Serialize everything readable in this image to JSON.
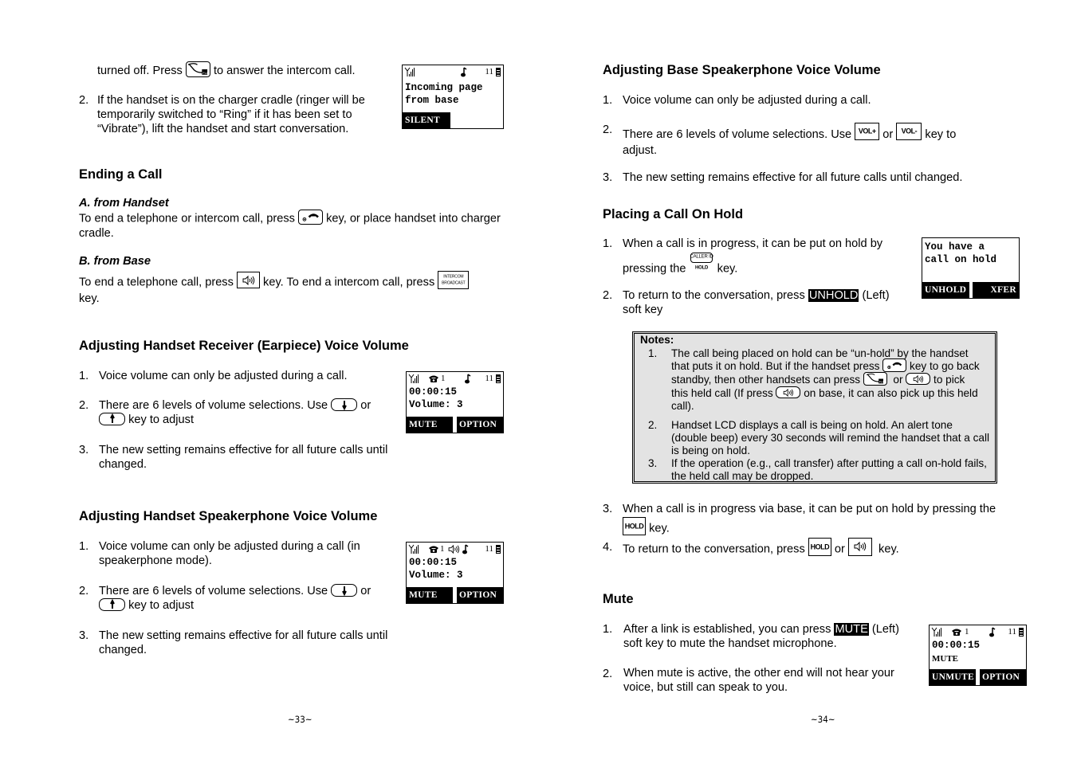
{
  "left_page": {
    "intro": {
      "line1_before": "turned off. Press",
      "line1_after": "to answer the intercom call.",
      "item2_num": "2.",
      "item2_text": "If the handset is on the charger cradle (ringer will be temporarily switched to “Ring” if it has been set to “Vibrate”), lift the handset and start conversation.",
      "lcd": {
        "line1": "Incoming page",
        "line2": "from base",
        "soft_left": "SILENT",
        "status_right": "11"
      }
    },
    "ending_call": {
      "title": "Ending a Call",
      "a_title": "A. from Handset",
      "a_before": "To end a telephone or intercom call, press",
      "a_after": "key, or place handset into charger cradle.",
      "b_title": "B. from Base",
      "b_before": "To end a telephone call, press",
      "b_mid": "key. To end a intercom call, press",
      "b_after": "key.",
      "intercom_key_line1": "INTERCOM",
      "intercom_key_line2": "BROADCAST"
    },
    "receiver_volume": {
      "title": "Adjusting Handset Receiver (Earpiece) Voice Volume",
      "items": [
        {
          "num": "1.",
          "text": "Voice volume can only be adjusted during a call."
        },
        {
          "num": "2.",
          "before": "There are 6 levels of volume selections.  Use",
          "mid": "or",
          "after": "key to adjust"
        },
        {
          "num": "3.",
          "text": "The new setting remains effective for all future calls until changed."
        }
      ],
      "lcd": {
        "line1": "00:00:15",
        "line2": "Volume: 3",
        "soft_left": "MUTE",
        "soft_right": "OPTION",
        "line_no": "1",
        "status_right": "11"
      }
    },
    "speaker_volume": {
      "title": "Adjusting Handset Speakerphone Voice Volume",
      "items": [
        {
          "num": "1.",
          "text": "Voice volume can only be adjusted during a call (in speakerphone mode)."
        },
        {
          "num": "2.",
          "before": "There are 6 levels of volume selections.  Use",
          "mid": "or",
          "after": "key to adjust"
        },
        {
          "num": "3.",
          "text": "The new setting remains effective for all future calls until changed."
        }
      ],
      "lcd": {
        "line1": "00:00:15",
        "line2": "Volume: 3",
        "soft_left": "MUTE",
        "soft_right": "OPTION",
        "line_no": "1",
        "status_right": "11"
      }
    },
    "page_number": "~33~"
  },
  "right_page": {
    "base_volume": {
      "title": "Adjusting Base Speakerphone Voice Volume",
      "item1_num": "1.",
      "item1_text": "Voice volume can only be adjusted during a call.",
      "item2_num": "2.",
      "item2_before": "There are 6 levels of volume selections.  Use",
      "item2_mid": "or",
      "item2_after": "key to",
      "item2_cont": "adjust.",
      "vol_up_key": "VOL+",
      "vol_down_key": "VOL-",
      "item3_num": "3.",
      "item3_text": "The new setting remains effective for all future calls until changed."
    },
    "hold": {
      "title": "Placing a Call On Hold",
      "item1_num": "1.",
      "item1_line1": "When a call is in progress, it can be put on hold by",
      "item1_before": "pressing the",
      "item1_after": "key.",
      "callerid_key_top": "CALLER ID",
      "callerid_key_bottom": "HOLD",
      "item2_num": "2.",
      "item2_before": "To return to the conversation, press",
      "item2_highlight": "UNHOLD",
      "item2_after": "(Left)",
      "item2_cont": "soft key",
      "lcd": {
        "line1": "You have a",
        "line2": "call on hold",
        "soft_left": "UNHOLD",
        "soft_right": "XFER"
      },
      "notes": {
        "title": "Notes:",
        "items": [
          {
            "num": "1.",
            "l1": "The call being placed on hold can be “un-hold” by the handset",
            "l2_before": "that puts it on hold. But if the handset press",
            "l2_after": "key to go back",
            "l3_before": "standby, then other handsets can press",
            "l3_mid": "or",
            "l3_after": "to pick",
            "l4_before": "this held call (If press",
            "l4_after": "on base, it can also pick up this held",
            "l5": "call)."
          },
          {
            "num": "2.",
            "text": "Handset LCD displays a call is being on hold.  An alert tone (double beep) every 30 seconds will remind the handset that a call is being on hold."
          },
          {
            "num": "3.",
            "text": "If the operation (e.g., call transfer) after putting a call on-hold fails, the held call may be dropped."
          }
        ]
      },
      "item3_num": "3.",
      "item3_line1": "When a call is in progress via base, it can be put on hold by pressing the",
      "item3_after": "key.",
      "item4_num": "4.",
      "item4_before": "To return to the conversation, press",
      "item4_mid": "or",
      "item4_after": "key.",
      "hold_key": "HOLD"
    },
    "mute": {
      "title": "Mute",
      "item1_num": "1.",
      "item1_before": "After a link is established, you can press",
      "item1_highlight": "MUTE",
      "item1_after": "(Left)",
      "item1_cont": "soft key to mute the handset microphone.",
      "item2_num": "2.",
      "item2_text": "When mute is active, the other end will not hear your voice, but still can speak to you.",
      "lcd": {
        "line1": "00:00:15",
        "line2": "MUTE",
        "soft_left": "UNMUTE",
        "soft_right": "OPTION",
        "line_no": "1",
        "status_right": "11"
      }
    },
    "page_number": "~34~"
  }
}
